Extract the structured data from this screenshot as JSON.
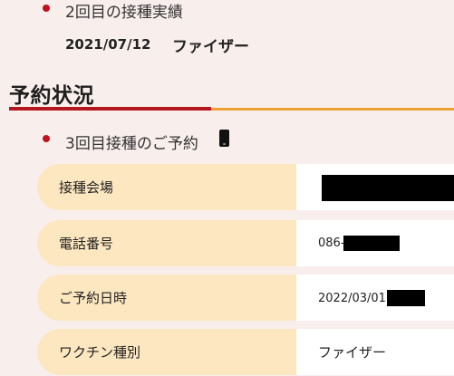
{
  "previous_record": {
    "label": "2回目の接種実績",
    "date": "2021/07/12",
    "vaccine": "ファイザー"
  },
  "section": {
    "title": "予約状況",
    "accent_colors": [
      "#b5171f",
      "#eca232"
    ]
  },
  "reservation": {
    "label": "3回目接種のご予約",
    "icon": "mobile-phone-icon",
    "rows": [
      {
        "label": "接種会場",
        "value": ""
      },
      {
        "label": "電話番号",
        "value": "086-"
      },
      {
        "label": "ご予約日時",
        "value": "2022/03/01"
      },
      {
        "label": "ワクチン種別",
        "value": "ファイザー"
      }
    ]
  },
  "colors": {
    "background": "#f8efed",
    "label_fill": "#fde7c0",
    "bullet": "#c1121c"
  }
}
